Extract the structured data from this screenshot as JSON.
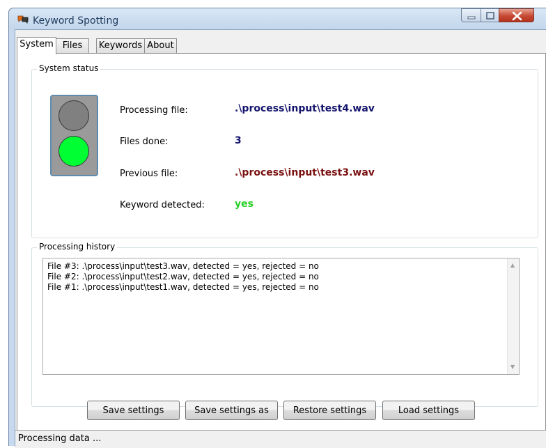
{
  "window": {
    "title": "Keyword Spotting"
  },
  "tabs": [
    {
      "label": "System",
      "active": true
    },
    {
      "label": "Files",
      "active": false
    },
    {
      "label": "Keywords",
      "active": false
    },
    {
      "label": "About",
      "active": false
    }
  ],
  "system_status": {
    "group_label": "System status",
    "processing_file": {
      "label": "Processing file:",
      "value": ".\\process\\input\\test4.wav"
    },
    "files_done": {
      "label": "Files done:",
      "value": "3"
    },
    "previous_file": {
      "label": "Previous file:",
      "value": ".\\process\\input\\test3.wav"
    },
    "keyword_detected": {
      "label": "Keyword detected:",
      "value": "yes"
    },
    "traffic_light": {
      "top_lamp": "off-gray",
      "bottom_lamp": "green-on"
    }
  },
  "processing_history": {
    "group_label": "Processing history",
    "lines": [
      "File #3: .\\process\\input\\test3.wav, detected = yes, rejected = no",
      "File #2: .\\process\\input\\test2.wav, detected = yes, rejected = no",
      "File #1: .\\process\\input\\test1.wav, detected = yes, rejected = no"
    ]
  },
  "buttons": {
    "save": "Save settings",
    "save_as": "Save settings as",
    "restore": "Restore settings",
    "load": "Load settings"
  },
  "statusbar": {
    "text": "Processing data ..."
  },
  "colors": {
    "processing_value": "#14146e",
    "previous_value": "#7a1010",
    "keyword_yes": "#26d026",
    "lamp_green": "#00ff33",
    "lamp_gray": "#808080"
  }
}
